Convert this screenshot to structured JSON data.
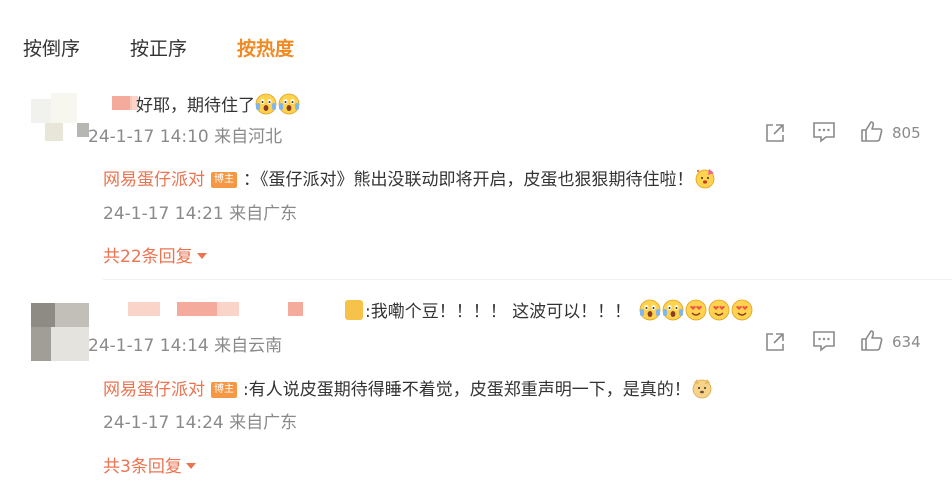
{
  "sort_tabs": [
    {
      "label": "按倒序",
      "active": false
    },
    {
      "label": "按正序",
      "active": false
    },
    {
      "label": "按热度",
      "active": true
    }
  ],
  "comments": [
    {
      "text": "好耶，期待住了",
      "emojis": [
        "scream-face",
        "scream-face"
      ],
      "time": "24-1-17 14:10 来自河北",
      "likes": "805",
      "reply": {
        "author": "网易蛋仔派对",
        "badge": "博主",
        "text": "：《蛋仔派对》熊出没联动即将开启，皮蛋也狠狠期待住啦！",
        "emojis": [
          "party-face"
        ],
        "time": "24-1-17 14:21 来自广东"
      },
      "more_replies": "共22条回复"
    },
    {
      "text": ":我嘞个豆！！！！ 这波可以！！！",
      "emojis": [
        "scream-face",
        "scream-face",
        "heart-eyes-face",
        "heart-eyes-face",
        "heart-eyes-face"
      ],
      "time": "24-1-17 14:14 来自云南",
      "likes": "634",
      "reply": {
        "author": "网易蛋仔派对",
        "badge": "博主",
        "text": ":有人说皮蛋期待得睡不着觉，皮蛋郑重声明一下，是真的！",
        "emojis": [
          "doge-face"
        ],
        "time": "24-1-17 14:24 来自广东"
      },
      "more_replies": "共3条回复"
    }
  ],
  "colors": {
    "accent": "#f08a24",
    "reply_name": "#eb7350",
    "badge": "#f49845",
    "meta": "#8a8a8a"
  }
}
